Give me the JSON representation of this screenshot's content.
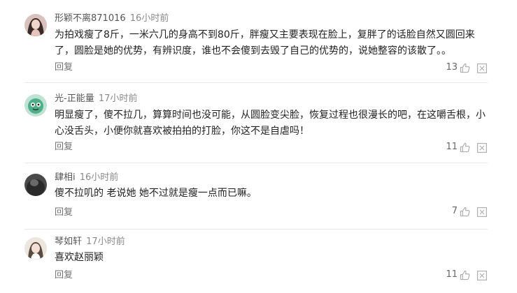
{
  "comments": [
    {
      "username": "形颖不离871016",
      "time": "16小时前",
      "text": "为拍戏瘦了8斤，一米六几的身高不到80斤，胖瘦又主要表现在脸上，复胖了的话脸自然又圆回来了，圆脸是她的优势，有辨识度，谁也不会傻到去毁了自己的优势的，说她整容的该散了。。",
      "reply_label": "回复",
      "likes": "13"
    },
    {
      "username": "光-正能量",
      "time": "17小时前",
      "text": "明显瘦了，傻不拉几，算算时间也没可能，从圆脸变尖脸，恢复过程也很漫长的吧，在这嚼舌根，小心没舌头，小便你就喜欢被拍拍的打脸，你这不是自虐吗！",
      "reply_label": "回复",
      "likes": "11"
    },
    {
      "username": "肆相i",
      "time": "16小时前",
      "text": "傻不拉叽的 老说她 她不过就是瘦一点而已嘛。",
      "reply_label": "回复",
      "likes": "7"
    },
    {
      "username": "琴如轩",
      "time": "17小时前",
      "text": "喜欢赵丽颖",
      "reply_label": "回复",
      "likes": "11"
    }
  ]
}
